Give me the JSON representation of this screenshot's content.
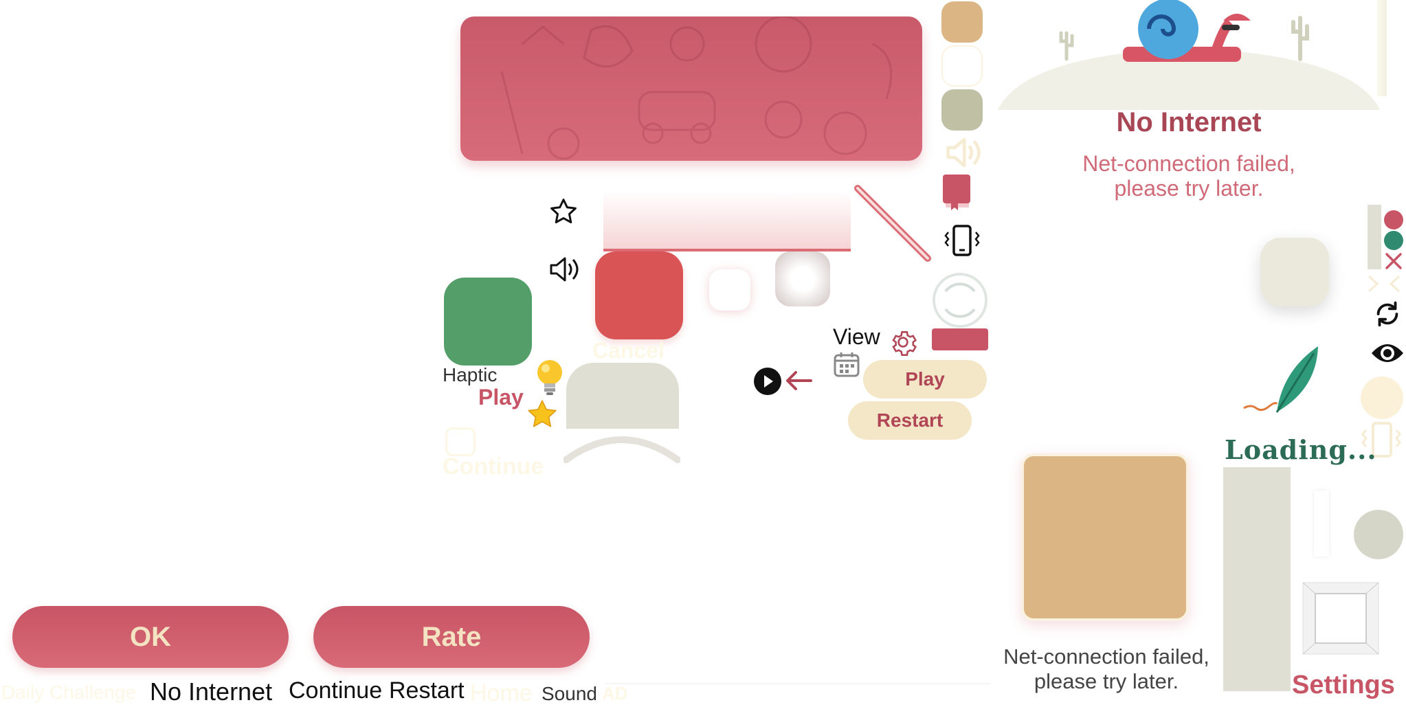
{
  "buttons": {
    "ok": "OK",
    "rate": "Rate",
    "play_pill": "Play",
    "restart_pill": "Restart"
  },
  "labels": {
    "haptic": "Haptic",
    "play": "Play",
    "cancel": "Cancel",
    "continue": "Continue",
    "view": "View",
    "loading": "Loading...",
    "settings": "Settings",
    "daily_challenge": "Daily Challenge",
    "no_internet_bottom": "No Internet",
    "continue_bottom": "Continue",
    "restart_bottom": "Restart",
    "home": "Home",
    "sound": "Sound",
    "ad": "AD"
  },
  "no_internet_dialog": {
    "title": "No Internet",
    "message_line1": "Net-connection failed,",
    "message_line2": "please try later."
  },
  "net_message_bottom": {
    "line1": "Net-connection failed,",
    "line2": "please try later."
  },
  "colors": {
    "primary": "#c85565",
    "green": "#549e6a",
    "red": "#d95455",
    "sand": "#dbb584",
    "sage": "#bfc0a4",
    "cream": "#f3e7c8",
    "beige": "#e0dfd4",
    "teal": "#2f8a70"
  },
  "icons": [
    "star-icon",
    "speaker-icon",
    "lightbulb-icon",
    "gold-star-icon",
    "play-circle-icon",
    "arrow-left-icon",
    "calendar-icon",
    "gear-icon",
    "phone-vibrate-icon",
    "book-icon",
    "refresh-icon",
    "eye-icon",
    "feather-icon",
    "close-icon",
    "snail-icon"
  ]
}
